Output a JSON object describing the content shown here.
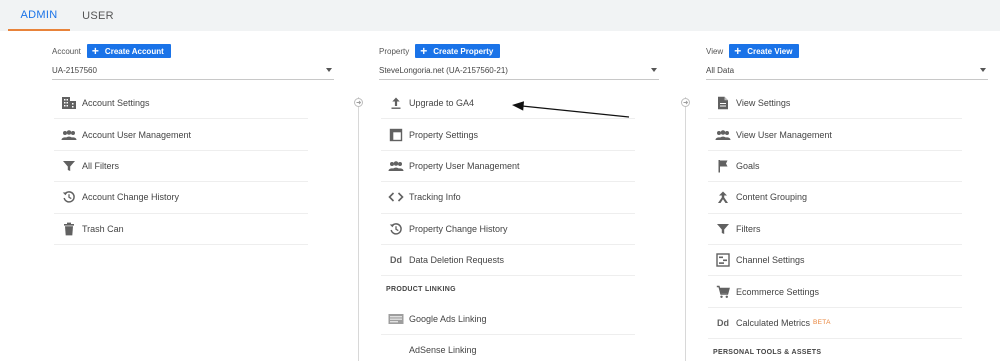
{
  "tabs": [
    {
      "label": "ADMIN",
      "active": true
    },
    {
      "label": "USER",
      "active": false
    }
  ],
  "account": {
    "label": "Account",
    "create_label": "Create Account",
    "selected": "UA-2157560",
    "items": [
      {
        "label": "Account Settings",
        "icon": "building-icon"
      },
      {
        "label": "Account User Management",
        "icon": "people-icon"
      },
      {
        "label": "All Filters",
        "icon": "filter-icon"
      },
      {
        "label": "Account Change History",
        "icon": "history-icon"
      },
      {
        "label": "Trash Can",
        "icon": "trash-icon"
      }
    ]
  },
  "property": {
    "label": "Property",
    "create_label": "Create Property",
    "selected": "SteveLongoria.net (UA-2157560-21)",
    "items": [
      {
        "label": "Upgrade to GA4",
        "icon": "upload-icon"
      },
      {
        "label": "Property Settings",
        "icon": "property-settings-icon"
      },
      {
        "label": "Property User Management",
        "icon": "people-icon"
      },
      {
        "label": "Tracking Info",
        "icon": "code-icon"
      },
      {
        "label": "Property Change History",
        "icon": "history-icon"
      },
      {
        "label": "Data Deletion Requests",
        "icon": "dd-icon",
        "glyph": "Dd"
      }
    ],
    "section_title": "PRODUCT LINKING",
    "linking": [
      {
        "label": "Google Ads Linking",
        "icon": "google-ads-icon"
      },
      {
        "label": "AdSense Linking",
        "icon": "adsense-icon"
      }
    ]
  },
  "view": {
    "label": "View",
    "create_label": "Create View",
    "selected": "All Data",
    "items": [
      {
        "label": "View Settings",
        "icon": "document-icon"
      },
      {
        "label": "View User Management",
        "icon": "people-icon"
      },
      {
        "label": "Goals",
        "icon": "flag-icon"
      },
      {
        "label": "Content Grouping",
        "icon": "grouping-icon"
      },
      {
        "label": "Filters",
        "icon": "filter-icon"
      },
      {
        "label": "Channel Settings",
        "icon": "channel-icon"
      },
      {
        "label": "Ecommerce Settings",
        "icon": "cart-icon"
      },
      {
        "label": "Calculated Metrics",
        "icon": "dd-icon",
        "glyph": "Dd",
        "badge": "BETA"
      }
    ],
    "section_title": "PERSONAL TOOLS & ASSETS"
  },
  "colors": {
    "accent": "#1a73e8",
    "tab_underline": "#e8833a",
    "icon": "#616161",
    "topbar": "#f1f3f4"
  }
}
